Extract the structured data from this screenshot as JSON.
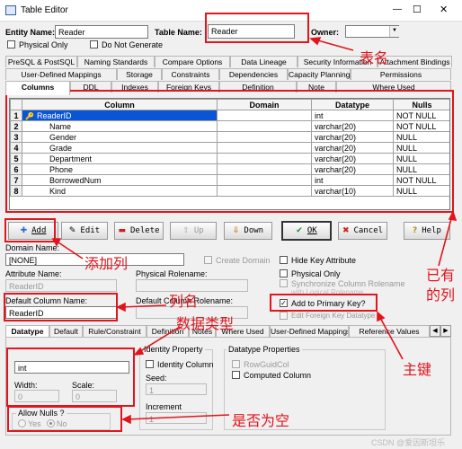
{
  "window": {
    "title": "Table Editor",
    "min": "—",
    "max": "☐",
    "close": "✕"
  },
  "header": {
    "entity_label": "Entity Name:",
    "entity_value": "Reader",
    "table_label": "Table Name:",
    "table_value": "Reader",
    "owner_label": "Owner:",
    "owner_value": ""
  },
  "options": {
    "physical_only": "Physical Only",
    "no_generate": "Do Not Generate"
  },
  "tabs_row1": [
    "PreSQL & PostSQL",
    "Naming Standards",
    "Compare Options",
    "Data Lineage",
    "Security Information",
    "Attachment Bindings"
  ],
  "tabs_row2": [
    "User-Defined Mappings",
    "Storage",
    "Constraints",
    "Dependencies",
    "Capacity Planning",
    "Permissions"
  ],
  "tabs_row3": [
    "Columns",
    "DDL",
    "Indexes",
    "Foreign Keys",
    "Definition",
    "Note",
    "Where Used"
  ],
  "grid": {
    "headers": [
      "Column",
      "Domain",
      "Datatype",
      "Nulls"
    ],
    "rows": [
      {
        "n": "1",
        "column": "ReaderID",
        "domain": "",
        "datatype": "int",
        "nulls": "NOT NULL"
      },
      {
        "n": "2",
        "column": "Name",
        "domain": "",
        "datatype": "varchar(20)",
        "nulls": "NOT NULL"
      },
      {
        "n": "3",
        "column": "Gender",
        "domain": "",
        "datatype": "varchar(20)",
        "nulls": "NULL"
      },
      {
        "n": "4",
        "column": "Grade",
        "domain": "",
        "datatype": "varchar(20)",
        "nulls": "NULL"
      },
      {
        "n": "5",
        "column": "Department",
        "domain": "",
        "datatype": "varchar(20)",
        "nulls": "NULL"
      },
      {
        "n": "6",
        "column": "Phone",
        "domain": "",
        "datatype": "varchar(20)",
        "nulls": "NULL"
      },
      {
        "n": "7",
        "column": "BorrowedNum",
        "domain": "",
        "datatype": "int",
        "nulls": "NOT NULL"
      },
      {
        "n": "8",
        "column": "Kind",
        "domain": "",
        "datatype": "varchar(10)",
        "nulls": "NULL"
      }
    ]
  },
  "buttons": {
    "add": "Add",
    "edit": "Edit",
    "delete": "Delete",
    "up": "Up",
    "down": "Down",
    "ok": "OK",
    "cancel": "Cancel",
    "help": "Help"
  },
  "detail": {
    "domain_label": "Domain Name:",
    "domain_value": "[NONE]",
    "create_domain": "Create Domain",
    "attr_label": "Attribute Name:",
    "attr_value": "ReaderID",
    "rolename_label": "Physical Rolename:",
    "default_col_label": "Default Column Name:",
    "default_col_value": "ReaderID",
    "default_rolename_label": "Default Column Rolename:",
    "hide_key": "Hide Key Attribute",
    "physical_only": "Physical Only",
    "sync_rolename": "Synchronize Column Rolename",
    "logical_rolename": "with Logical Rolename",
    "add_pk": "Add to Primary Key?",
    "edit_fk": "Edit Foreign Key Datatype"
  },
  "tabs_bottom": [
    "Datatype",
    "Default",
    "Rule/Constraint",
    "Definition",
    "Notes",
    "Where Used",
    "User-Defined Mappings",
    "Reference Values"
  ],
  "datatype": {
    "value": "int",
    "width_label": "Width:",
    "width_value": "0",
    "scale_label": "Scale:",
    "scale_value": "0",
    "allow_nulls": "Allow Nulls ?",
    "yes": "Yes",
    "no": "No",
    "identity_title": "Identity Property",
    "identity_column": "Identity Column",
    "seed_label": "Seed:",
    "seed_value": "1",
    "increment_label": "Increment",
    "increment_value": "1",
    "props_title": "Datatype Properties",
    "rowguidcol": "RowGuidCol",
    "computed": "Computed Column"
  },
  "annotations": {
    "table_name": "表名",
    "add_column": "添加列",
    "existing_cols": "已有\n的列",
    "col_name": "列名",
    "datatype": "数据类型",
    "primary_key": "主键",
    "nullable": "是否为空"
  },
  "watermark": "CSDN @爱因斯坦乐",
  "colors": {
    "selection": "#0a54d6",
    "annotation": "#e0151d",
    "ok_check": "#2a8a2a",
    "delete_x": "#cc1f1f"
  }
}
